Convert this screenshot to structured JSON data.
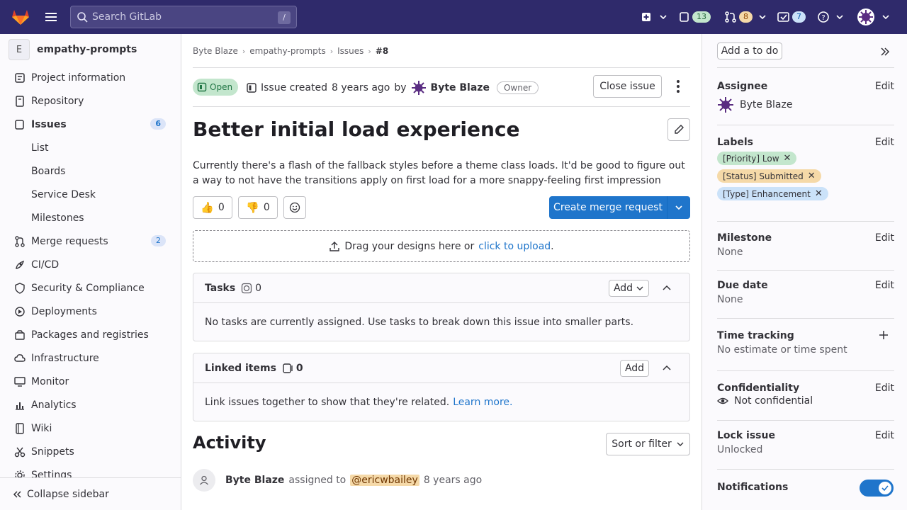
{
  "search": {
    "placeholder": "Search GitLab",
    "shortcut": "/"
  },
  "topbar": {
    "issues_count": "13",
    "mr_count": "8",
    "todos_count": "7"
  },
  "project": {
    "avatar_letter": "E",
    "name": "empathy-prompts"
  },
  "sidebar": {
    "items": [
      {
        "label": "Project information"
      },
      {
        "label": "Repository"
      },
      {
        "label": "Issues",
        "count": "6"
      },
      {
        "label": "List"
      },
      {
        "label": "Boards"
      },
      {
        "label": "Service Desk"
      },
      {
        "label": "Milestones"
      },
      {
        "label": "Merge requests",
        "count": "2"
      },
      {
        "label": "CI/CD"
      },
      {
        "label": "Security & Compliance"
      },
      {
        "label": "Deployments"
      },
      {
        "label": "Packages and registries"
      },
      {
        "label": "Infrastructure"
      },
      {
        "label": "Monitor"
      },
      {
        "label": "Analytics"
      },
      {
        "label": "Wiki"
      },
      {
        "label": "Snippets"
      },
      {
        "label": "Settings"
      }
    ],
    "collapse_label": "Collapse sidebar"
  },
  "breadcrumb": [
    "Byte Blaze",
    "empathy-prompts",
    "Issues",
    "#8"
  ],
  "issue": {
    "status": "Open",
    "created_prefix": "Issue created",
    "created_when": "8 years ago",
    "created_by_word": "by",
    "author": "Byte Blaze",
    "author_role": "Owner",
    "close_label": "Close issue",
    "title": "Better initial load experience",
    "description": "Currently there's a flash of the fallback styles before a theme class loads. It'd be good to figure out a way to not have the transitions apply on first load for a more snappy-feeling first impression",
    "thumbs_up": "0",
    "thumbs_down": "0",
    "merge_label": "Create merge request",
    "drop_text": "Drag your designs here or",
    "drop_link": "click to upload",
    "drop_end": "."
  },
  "tasks": {
    "title": "Tasks",
    "count": "0",
    "add_label": "Add",
    "empty": "No tasks are currently assigned. Use tasks to break down this issue into smaller parts."
  },
  "linked": {
    "title": "Linked items",
    "count": "0",
    "add_label": "Add",
    "text": "Link issues together to show that they're related.",
    "learn_more": "Learn more."
  },
  "activity": {
    "title": "Activity",
    "sort_label": "Sort or filter",
    "entry": {
      "actor": "Byte Blaze",
      "action": "assigned to",
      "mention": "@ericwbailey",
      "when": "8 years ago"
    }
  },
  "right": {
    "todo_label": "Add a to do",
    "edit_label": "Edit",
    "assignee_title": "Assignee",
    "assignee": "Byte Blaze",
    "labels_title": "Labels",
    "labels": [
      {
        "text": "[Priority] Low",
        "color": "#c3e6cd"
      },
      {
        "text": "[Status] Submitted",
        "color": "#f5d9a8"
      },
      {
        "text": "[Type] Enhancement",
        "color": "#cbe2f9"
      }
    ],
    "milestone_title": "Milestone",
    "milestone": "None",
    "due_title": "Due date",
    "due": "None",
    "time_title": "Time tracking",
    "time": "No estimate or time spent",
    "conf_title": "Confidentiality",
    "conf": "Not confidential",
    "lock_title": "Lock issue",
    "lock": "Unlocked",
    "notif_title": "Notifications"
  }
}
